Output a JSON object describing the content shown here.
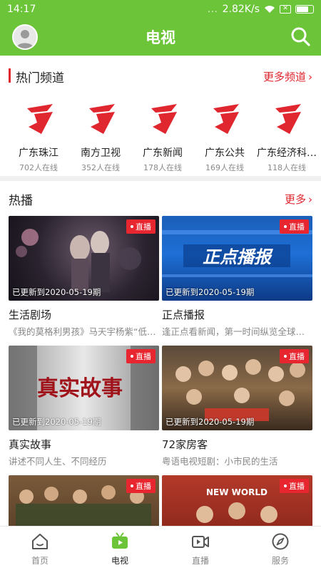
{
  "status_bar": {
    "time": "14:17",
    "signal": "...",
    "speed": "2.82K/s"
  },
  "header": {
    "title": "电视",
    "avatar": "avatar-icon",
    "search_icon": "search-icon"
  },
  "hot_channels": {
    "title": "热门频道",
    "more_label": "更多频道",
    "items": [
      {
        "name": "广东珠江",
        "online": "702人在线"
      },
      {
        "name": "南方卫视",
        "online": "352人在线"
      },
      {
        "name": "广东新闻",
        "online": "178人在线"
      },
      {
        "name": "广东公共",
        "online": "169人在线"
      },
      {
        "name": "广东经济科…",
        "online": "118人在线"
      }
    ]
  },
  "hot_broadcast": {
    "title": "热播",
    "more_label": "更多",
    "live_label": "直播",
    "cards": [
      {
        "title": "生活剧场",
        "desc": "《我的莫格利男孩》马天宇杨紫“低…",
        "updated": "已更新到2020-05-19期",
        "thumb_text": ""
      },
      {
        "title": "正点播报",
        "desc": "逢正点看新闻，第一时间纵览全球…",
        "updated": "已更新到2020-05-19期",
        "thumb_text": "正点播报"
      },
      {
        "title": "真实故事",
        "desc": "讲述不同人生、不同经历",
        "updated": "已更新到2020-05-19期",
        "thumb_text": "真实故事"
      },
      {
        "title": "72家房客",
        "desc": "粤语电视短剧：小市民的生活",
        "updated": "已更新到2020-05-19期",
        "thumb_text": ""
      },
      {
        "title": "",
        "desc": "",
        "updated": "",
        "thumb_text": ""
      },
      {
        "title": "",
        "desc": "",
        "updated": "",
        "thumb_text": "NEW WORLD"
      }
    ]
  },
  "bottom_nav": [
    {
      "label": "首页",
      "icon": "home-icon"
    },
    {
      "label": "电视",
      "icon": "tv-icon"
    },
    {
      "label": "直播",
      "icon": "live-camera-icon"
    },
    {
      "label": "服务",
      "icon": "compass-icon"
    }
  ],
  "colors": {
    "brand_green": "#6cc439",
    "accent_red": "#e0262e"
  }
}
